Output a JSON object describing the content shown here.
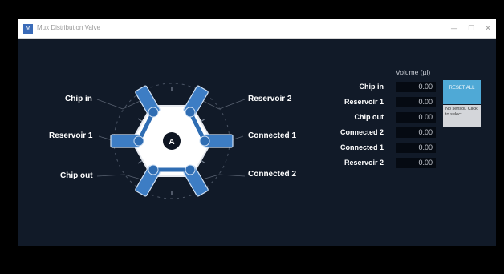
{
  "window": {
    "title": "Mux Distribution Valve",
    "app_icon_letter": "M",
    "controls": {
      "minimize": "—",
      "maximize": "☐",
      "close": "✕"
    }
  },
  "valve": {
    "center_label": "A",
    "ports": {
      "top_left": "Chip in",
      "left": "Reservoir 1",
      "bottom_left": "Chip out",
      "top_right": "Reservoir 2",
      "right": "Connected 1",
      "bottom_right": "Connected 2"
    }
  },
  "volumes": {
    "header": "Volume (µl)",
    "rows": [
      {
        "label": "Chip in",
        "value": "0.00"
      },
      {
        "label": "Reservoir 1",
        "value": "0.00"
      },
      {
        "label": "Chip out",
        "value": "0.00"
      },
      {
        "label": "Connected 2",
        "value": "0.00"
      },
      {
        "label": "Connected 1",
        "value": "0.00"
      },
      {
        "label": "Reservoir 2",
        "value": "0.00"
      }
    ]
  },
  "reset_button": {
    "label": "RESET ALL"
  },
  "sensor_status": {
    "text": "No sensor. Click to select"
  },
  "colors": {
    "background": "#111a28",
    "accent": "#4fa9d6",
    "valve_blue": "#3d7dc4"
  }
}
